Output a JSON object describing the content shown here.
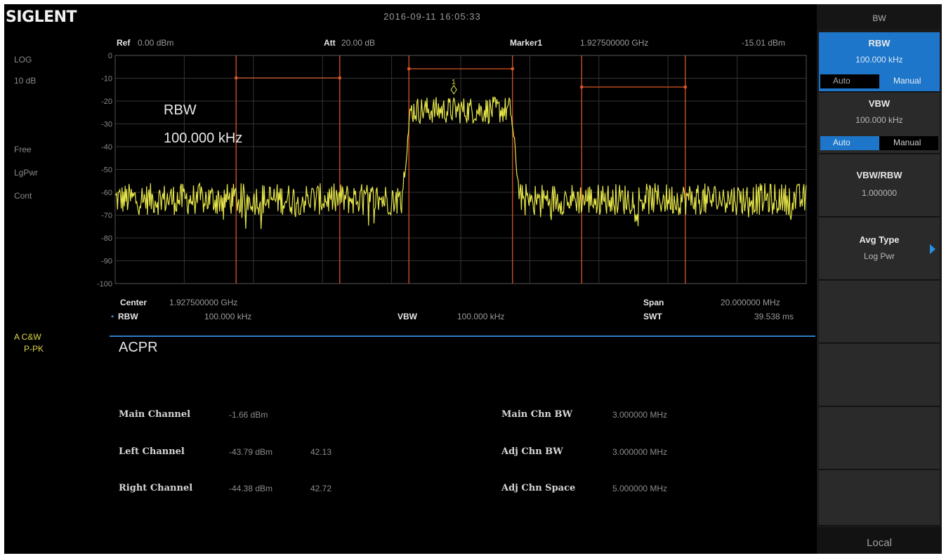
{
  "brand": "SIGLENT",
  "datetime": "2016-09-11  16:05:33",
  "left_status": {
    "scale_type": "LOG",
    "scale_div": "10 dB",
    "free": "Free",
    "lgpwr": "LgPwr",
    "cont": "Cont",
    "trace_name": "A  C&W",
    "trace_detector": "P-PK"
  },
  "header": {
    "ref_label": "Ref",
    "ref_value": "0.00 dBm",
    "att_label": "Att",
    "att_value": "20.00 dB",
    "marker_label": "Marker1",
    "marker_freq": "1.927500000  GHz",
    "marker_level": "-15.01  dBm"
  },
  "overlay": {
    "rbw_label": "RBW",
    "rbw_value": "100.000  kHz"
  },
  "y_ticks": [
    "0",
    "-10",
    "-20",
    "-30",
    "-40",
    "-50",
    "-60",
    "-70",
    "-80",
    "-90",
    "-100"
  ],
  "footer": {
    "center_label": "Center",
    "center_value": "1.927500000  GHz",
    "span_label": "Span",
    "span_value": "20.000000  MHz",
    "rbw_label": "RBW",
    "rbw_value": "100.000  kHz",
    "vbw_label": "VBW",
    "vbw_value": "100.000  kHz",
    "swt_label": "SWT",
    "swt_value": "39.538  ms"
  },
  "measurement": {
    "title": "ACPR",
    "main_channel_label": "Main Channel",
    "main_channel_value": "-1.66  dBm",
    "left_channel_label": "Left Channel",
    "left_channel_value": "-43.79  dBm",
    "left_channel_ratio": "42.13",
    "right_channel_label": "Right Channel",
    "right_channel_value": "-44.38  dBm",
    "right_channel_ratio": "42.72",
    "main_bw_label": "Main Chn BW",
    "main_bw_value": "3.000000  MHz",
    "adj_bw_label": "Adj Chn BW",
    "adj_bw_value": "3.000000  MHz",
    "adj_space_label": "Adj Chn Space",
    "adj_space_value": "5.000000  MHz"
  },
  "softkeys": {
    "menu_title": "BW",
    "rbw_title": "RBW",
    "rbw_value": "100.000  kHz",
    "rbw_auto": "Auto",
    "rbw_manual": "Manual",
    "vbw_title": "VBW",
    "vbw_value": "100.000  kHz",
    "vbw_auto": "Auto",
    "vbw_manual": "Manual",
    "vbw_rbw_title": "VBW/RBW",
    "vbw_rbw_value": "1.000000",
    "avg_type_title": "Avg Type",
    "avg_type_value": "Log Pwr",
    "local": "Local"
  },
  "colors": {
    "trace": "#e6e64a",
    "channel_lines": "#d9562a",
    "accent_blue": "#2b7fc6",
    "trace_indicator": "#e6e64a"
  }
}
